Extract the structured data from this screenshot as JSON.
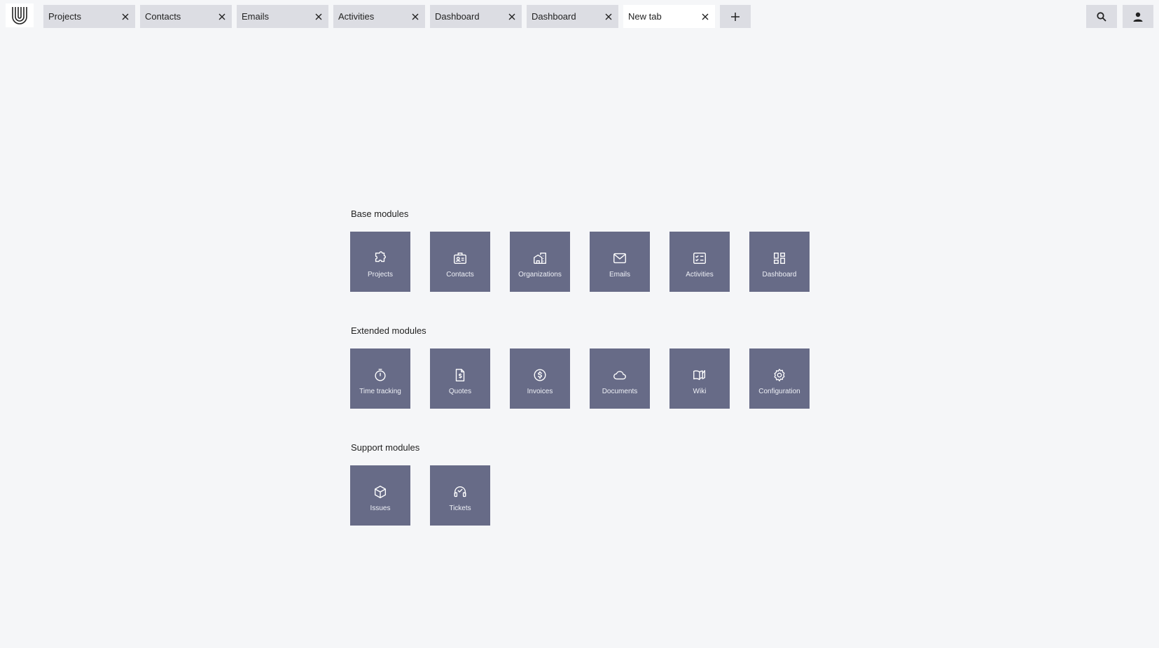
{
  "tabs": [
    {
      "label": "Projects"
    },
    {
      "label": "Contacts"
    },
    {
      "label": "Emails"
    },
    {
      "label": "Activities"
    },
    {
      "label": "Dashboard"
    },
    {
      "label": "Dashboard"
    },
    {
      "label": "New tab",
      "active": true
    }
  ],
  "sections": {
    "base": {
      "title": "Base modules",
      "modules": [
        {
          "label": "Projects",
          "icon": "puzzle-icon"
        },
        {
          "label": "Contacts",
          "icon": "contact-card-icon"
        },
        {
          "label": "Organizations",
          "icon": "buildings-icon"
        },
        {
          "label": "Emails",
          "icon": "envelope-icon"
        },
        {
          "label": "Activities",
          "icon": "checklist-icon"
        },
        {
          "label": "Dashboard",
          "icon": "dashboard-grid-icon"
        }
      ]
    },
    "extended": {
      "title": "Extended modules",
      "modules": [
        {
          "label": "Time tracking",
          "icon": "stopwatch-icon"
        },
        {
          "label": "Quotes",
          "icon": "dollar-document-icon"
        },
        {
          "label": "Invoices",
          "icon": "dollar-circle-icon"
        },
        {
          "label": "Documents",
          "icon": "cloud-icon"
        },
        {
          "label": "Wiki",
          "icon": "open-book-icon"
        },
        {
          "label": "Configuration",
          "icon": "gear-icon"
        }
      ]
    },
    "support": {
      "title": "Support modules",
      "modules": [
        {
          "label": "Issues",
          "icon": "cube-icon"
        },
        {
          "label": "Tickets",
          "icon": "headset-icon"
        }
      ]
    }
  },
  "colors": {
    "tile": "#676b87",
    "tab": "#dcdde3",
    "active_tab": "#ffffff",
    "background": "#f5f6f8"
  }
}
